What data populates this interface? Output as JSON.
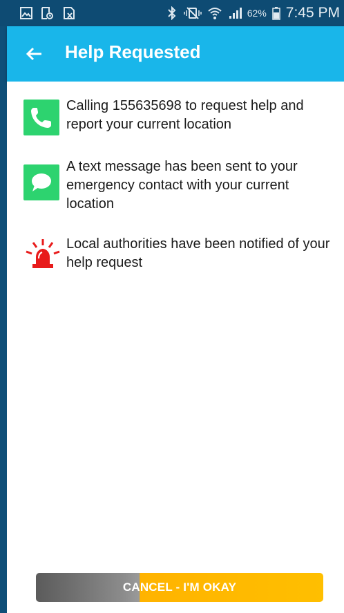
{
  "status_bar": {
    "left_icons": [
      "gallery-icon",
      "clipboard-clock-icon",
      "excel-file-icon"
    ],
    "right_icons": [
      "bluetooth-icon",
      "vibrate-mute-icon",
      "wifi-icon",
      "signal-icon",
      "battery-icon"
    ],
    "battery_percent": "62%",
    "time": "7:45 PM"
  },
  "app_bar": {
    "title": "Help Requested",
    "color": "#19b6ea"
  },
  "notifications": [
    {
      "icon": "phone-icon",
      "text": "Calling 155635698 to request help and report your current location"
    },
    {
      "icon": "chat-bubble-icon",
      "text": "A text message has been sent to your emergency contact with your current location"
    },
    {
      "icon": "siren-icon",
      "text": "Local authorities have been notified of your help request"
    }
  ],
  "cancel_slider": {
    "label": "CANCEL - I'M OKAY",
    "progress": 0.36,
    "track_color": "#ffbf00",
    "fill_color": "#8c8c8c"
  },
  "colors": {
    "accent_green": "#2dd36f",
    "alert_red": "#e81b1b",
    "status_bar_bg": "#0e4b73"
  }
}
